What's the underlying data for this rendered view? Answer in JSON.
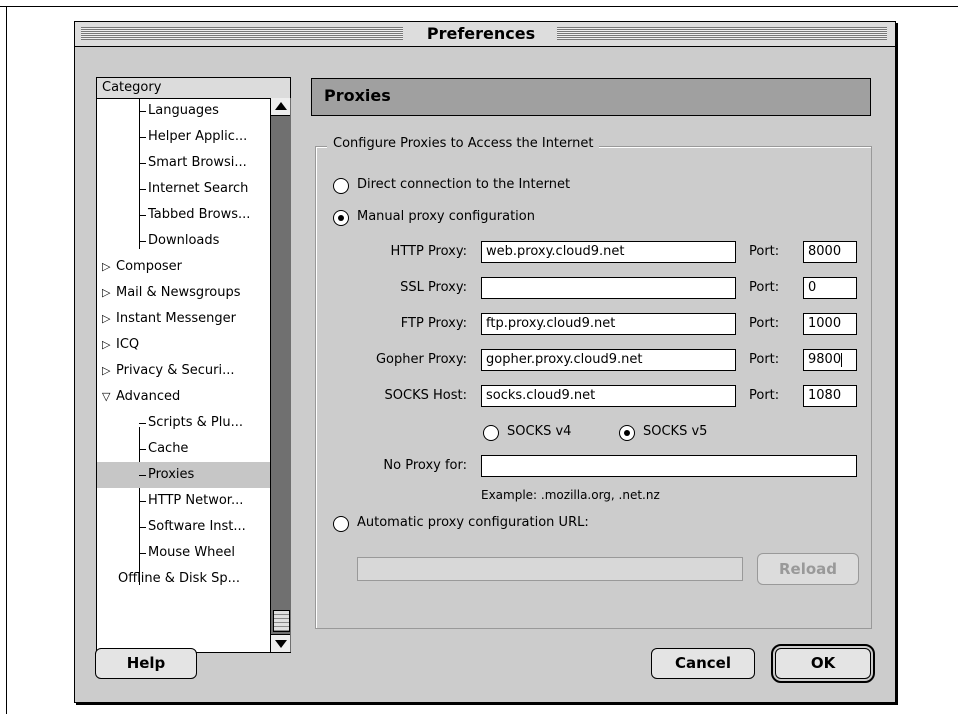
{
  "window": {
    "title": "Preferences"
  },
  "category": {
    "header": "Category",
    "items": [
      {
        "label": "Languages",
        "level": 1
      },
      {
        "label": "Helper Applic...",
        "level": 1
      },
      {
        "label": "Smart Browsi...",
        "level": 1
      },
      {
        "label": "Internet Search",
        "level": 1
      },
      {
        "label": "Tabbed Brows...",
        "level": 1
      },
      {
        "label": "Downloads",
        "level": 1
      },
      {
        "label": "Composer",
        "level": 0,
        "expander": "▷"
      },
      {
        "label": "Mail & Newsgroups",
        "level": 0,
        "expander": "▷"
      },
      {
        "label": "Instant Messenger",
        "level": 0,
        "expander": "▷"
      },
      {
        "label": "ICQ",
        "level": 0,
        "expander": "▷"
      },
      {
        "label": "Privacy & Securi...",
        "level": 0,
        "expander": "▷"
      },
      {
        "label": "Advanced",
        "level": 0,
        "expander": "▽"
      },
      {
        "label": "Scripts & Plu...",
        "level": 1
      },
      {
        "label": "Cache",
        "level": 1
      },
      {
        "label": "Proxies",
        "level": 1,
        "selected": true
      },
      {
        "label": "HTTP Networ...",
        "level": 1
      },
      {
        "label": "Software Inst...",
        "level": 1
      },
      {
        "label": "Mouse Wheel",
        "level": 1
      },
      {
        "label": "Offline & Disk Sp...",
        "level": 0
      }
    ]
  },
  "panel": {
    "title": "Proxies",
    "group_label": "Configure Proxies to Access the Internet",
    "direct_label": "Direct connection to the Internet",
    "manual_label": "Manual proxy configuration",
    "port_label": "Port:",
    "proxies": [
      {
        "label": "HTTP Proxy:",
        "value": "web.proxy.cloud9.net",
        "port": "8000"
      },
      {
        "label": "SSL Proxy:",
        "value": "",
        "port": "0"
      },
      {
        "label": "FTP Proxy:",
        "value": "ftp.proxy.cloud9.net",
        "port": "1000"
      },
      {
        "label": "Gopher Proxy:",
        "value": "gopher.proxy.cloud9.net",
        "port": "9800"
      },
      {
        "label": "SOCKS Host:",
        "value": "socks.cloud9.net",
        "port": "1080"
      }
    ],
    "socks_v4_label": "SOCKS v4",
    "socks_v5_label": "SOCKS v5",
    "no_proxy_label": "No Proxy for:",
    "no_proxy_value": "",
    "example_text": "Example: .mozilla.org, .net.nz",
    "auto_label": "Automatic proxy configuration URL:",
    "auto_url_value": "",
    "reload_label": "Reload"
  },
  "buttons": {
    "help": "Help",
    "cancel": "Cancel",
    "ok": "OK"
  },
  "selection": {
    "connection": "manual",
    "socks_version": "v5"
  }
}
